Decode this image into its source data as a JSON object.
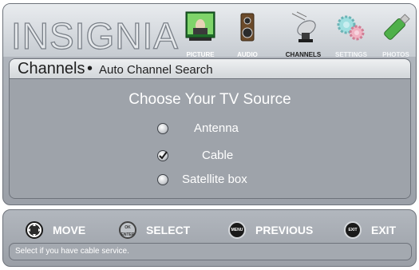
{
  "brand": {
    "logo_text": "INSIGNIA"
  },
  "menu": {
    "items": [
      {
        "label": "PICTURE",
        "icon": "picture-icon"
      },
      {
        "label": "AUDIO",
        "icon": "speaker-icon"
      },
      {
        "label": "CHANNELS",
        "icon": "satellite-dish-icon"
      },
      {
        "label": "SETTINGS",
        "icon": "gears-icon"
      },
      {
        "label": "PHOTOS",
        "icon": "usb-drive-icon"
      }
    ],
    "active": "CHANNELS"
  },
  "breadcrumb": {
    "section": "Channels",
    "separator": "•",
    "page": "Auto Channel Search"
  },
  "main": {
    "title": "Choose Your TV Source",
    "options": [
      {
        "label": "Antenna",
        "selected": false
      },
      {
        "label": "Cable",
        "selected": true
      },
      {
        "label": "Satellite box",
        "selected": false
      }
    ]
  },
  "footer": {
    "hints": [
      {
        "key_label": "",
        "action": "MOVE",
        "icon": "dpad-icon"
      },
      {
        "key_label": "OK ENTER",
        "action": "SELECT",
        "icon": "ok-enter-button-icon"
      },
      {
        "key_label": "MENU",
        "action": "PREVIOUS",
        "icon": "menu-button-icon"
      },
      {
        "key_label": "EXIT",
        "action": "EXIT",
        "icon": "exit-button-icon"
      }
    ],
    "status": "Select if you have cable service."
  },
  "colors": {
    "panel_bg": "#9ea3aa",
    "header_bg": "#e9ecef",
    "text_light": "#ffffff",
    "text_dark": "#1f1f1f"
  }
}
